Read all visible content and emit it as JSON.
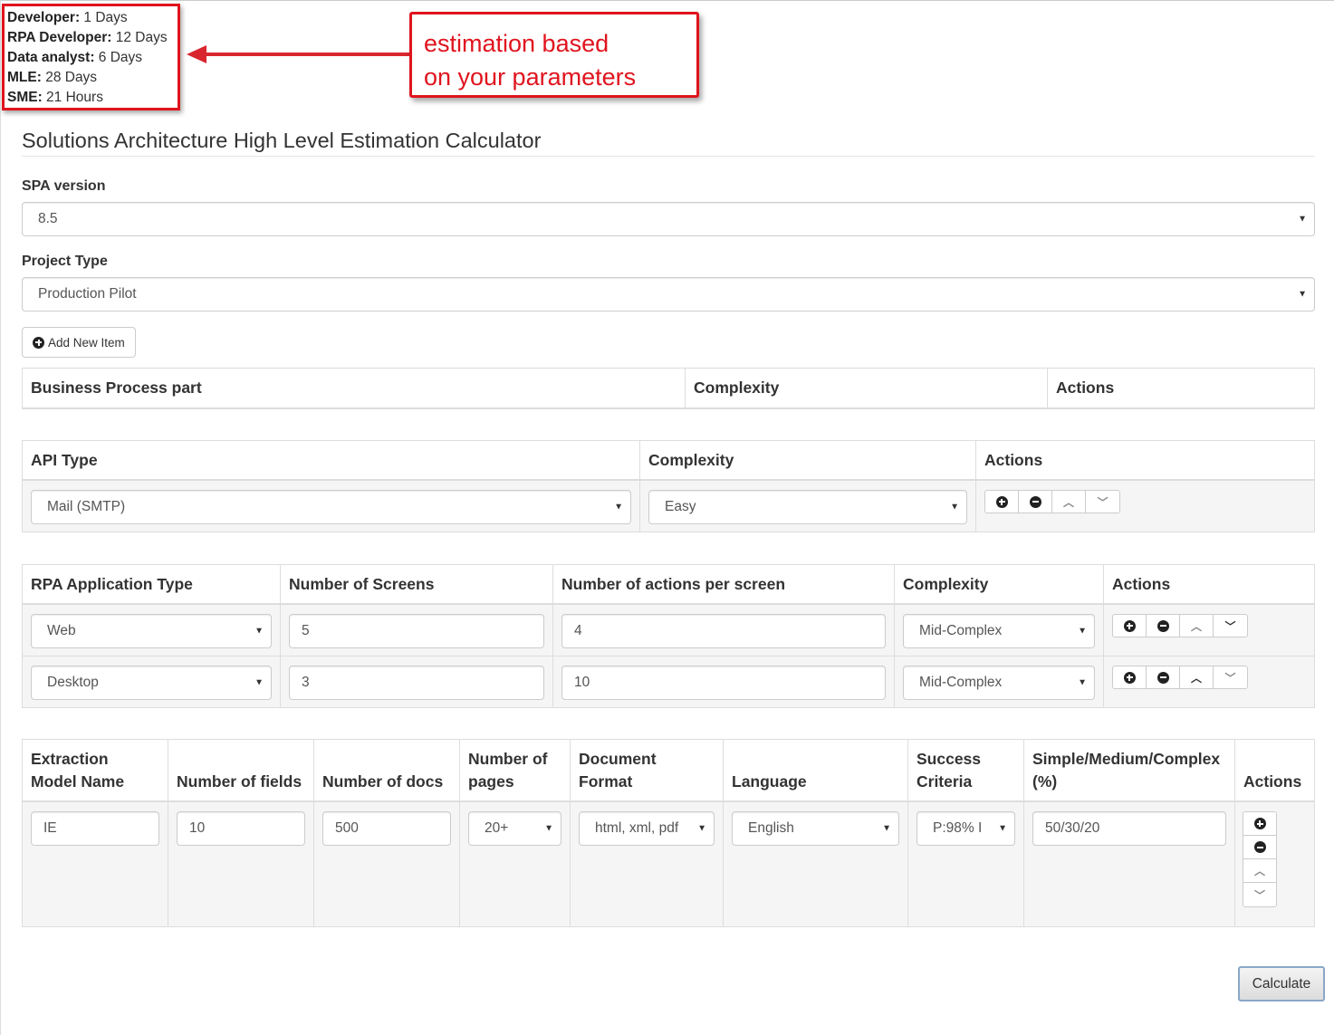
{
  "estimate": {
    "lines": [
      {
        "label": "Developer:",
        "value": " 1 Days"
      },
      {
        "label": "RPA Developer:",
        "value": " 12 Days"
      },
      {
        "label": "Data analyst:",
        "value": " 6 Days"
      },
      {
        "label": "MLE:",
        "value": " 28 Days"
      },
      {
        "label": "SME:",
        "value": " 21 Hours"
      }
    ]
  },
  "callout": {
    "line1": "estimation based",
    "line2": "on your parameters"
  },
  "page_title": "Solutions Architecture High Level Estimation Calculator",
  "spa_version": {
    "label": "SPA version",
    "value": "8.5"
  },
  "project_type": {
    "label": "Project Type",
    "value": "Production Pilot"
  },
  "add_item_label": "Add New Item",
  "business_table": {
    "headers": [
      "Business Process part",
      "Complexity",
      "Actions"
    ]
  },
  "api_table": {
    "headers": [
      "API Type",
      "Complexity",
      "Actions"
    ],
    "rows": [
      {
        "type": "Mail (SMTP)",
        "complexity": "Easy"
      }
    ]
  },
  "rpa_table": {
    "headers": [
      "RPA Application Type",
      "Number of Screens",
      "Number of actions per screen",
      "Complexity",
      "Actions"
    ],
    "rows": [
      {
        "type": "Web",
        "screens": "5",
        "actions": "4",
        "complexity": "Mid-Complex"
      },
      {
        "type": "Desktop",
        "screens": "3",
        "actions": "10",
        "complexity": "Mid-Complex"
      }
    ]
  },
  "extraction_table": {
    "headers": {
      "model_name": [
        "Extraction",
        "Model Name"
      ],
      "fields": "Number of fields",
      "docs": "Number of docs",
      "pages": [
        "Number of",
        "pages"
      ],
      "format": [
        "Document",
        "Format"
      ],
      "language": "Language",
      "success": [
        "Success",
        "Criteria"
      ],
      "ratio": [
        "Simple/Medium/Complex",
        "(%)"
      ],
      "actions": "Actions"
    },
    "rows": [
      {
        "model_name": "IE",
        "fields": "10",
        "docs": "500",
        "pages": "20+",
        "format": "html, xml, pdf",
        "language": "English",
        "success": "P:98% I",
        "ratio": "50/30/20"
      }
    ]
  },
  "calculate_label": "Calculate"
}
